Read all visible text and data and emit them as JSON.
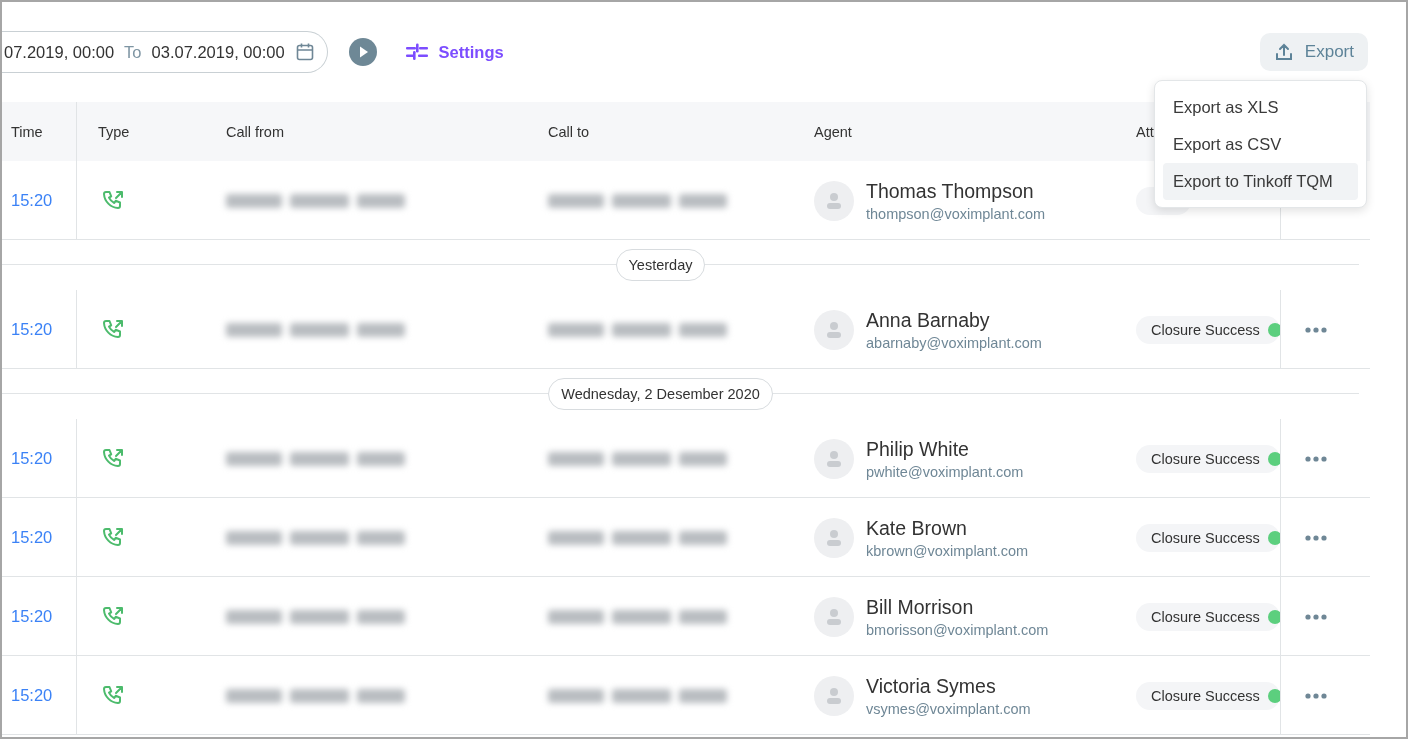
{
  "toolbar": {
    "date_from": "07.2019, 00:00",
    "to_label": "To",
    "date_to": "03.07.2019, 00:00",
    "settings_label": "Settings",
    "export_label": "Export"
  },
  "export_menu": {
    "items": [
      {
        "label": "Export as XLS",
        "selected": false
      },
      {
        "label": "Export as CSV",
        "selected": false
      },
      {
        "label": "Export to Tinkoff TQM",
        "selected": true
      }
    ]
  },
  "table": {
    "columns": [
      "Time",
      "Type",
      "Call from",
      "Call to",
      "Agent",
      "Att"
    ],
    "groups": [
      {
        "rows": [
          {
            "time": "15:20",
            "agent_name": "Thomas Thompson",
            "agent_email": "thompson@voximplant.com"
          }
        ]
      },
      {
        "divider": "Yesterday",
        "rows": [
          {
            "time": "15:20",
            "agent_name": "Anna Barnaby",
            "agent_email": "abarnaby@voximplant.com",
            "tag": "Closure Success"
          }
        ]
      },
      {
        "divider": "Wednesday, 2 Desember 2020",
        "rows": [
          {
            "time": "15:20",
            "agent_name": "Philip White",
            "agent_email": "pwhite@voximplant.com",
            "tag": "Closure Success"
          },
          {
            "time": "15:20",
            "agent_name": "Kate Brown",
            "agent_email": "kbrown@voximplant.com",
            "tag": "Closure Success"
          },
          {
            "time": "15:20",
            "agent_name": "Bill Morrison",
            "agent_email": "bmorisson@voximplant.com",
            "tag": "Closure Success"
          },
          {
            "time": "15:20",
            "agent_name": "Victoria Symes",
            "agent_email": "vsymes@voximplant.com",
            "tag": "Closure Success"
          }
        ]
      }
    ]
  }
}
